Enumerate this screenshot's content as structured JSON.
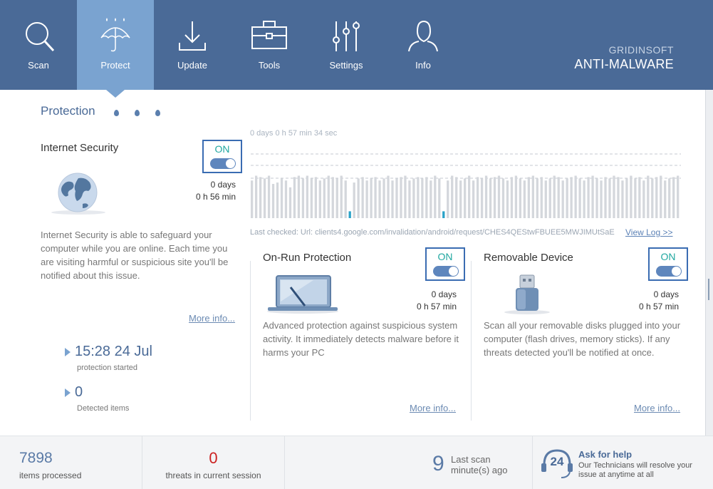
{
  "nav": {
    "tabs": [
      {
        "label": "Scan",
        "icon": "magnifier-icon"
      },
      {
        "label": "Protect",
        "icon": "umbrella-icon",
        "active": true
      },
      {
        "label": "Update",
        "icon": "download-icon"
      },
      {
        "label": "Tools",
        "icon": "toolbox-icon"
      },
      {
        "label": "Settings",
        "icon": "sliders-icon"
      },
      {
        "label": "Info",
        "icon": "person-icon"
      }
    ]
  },
  "brand": {
    "top": "GRIDINSOFT",
    "bottom": "ANTI-MALWARE"
  },
  "protection": {
    "title": "Protection"
  },
  "internet_security": {
    "title": "Internet Security",
    "toggle": "ON",
    "days": "0 days",
    "time": "0 h 56 min",
    "description": "Internet Security is able to safeguard your computer while you are online. Each time you are visiting harmful or suspicious site you'll  be notified about this issue.",
    "more": "More info..."
  },
  "stats": {
    "started_value": "15:28 24 Jul",
    "started_label": "protection started",
    "detected_value": "0",
    "detected_label": "Detected items"
  },
  "chart": {
    "elapsed": "0 days 0 h 57 min 34 sec",
    "last_checked": "Last checked: Url: clients4.google.com/invalidation/android/request/CHES4QEStwFBUEE5MWJIMUtSaE",
    "view_log": "View Log >>",
    "bar_color": "#d4d7dc",
    "highlight_color": "#2aa2c8"
  },
  "chart_data": {
    "type": "bar",
    "values": [
      0.55,
      0.62,
      0.6,
      0.58,
      0.62,
      0.5,
      0.52,
      0.58,
      0.55,
      0.45,
      0.6,
      0.62,
      0.58,
      0.62,
      0.58,
      0.6,
      0.55,
      0.58,
      0.62,
      0.6,
      0.58,
      0.62,
      0.55,
      0.1,
      0.52,
      0.58,
      0.6,
      0.55,
      0.58,
      0.6,
      0.55,
      0.58,
      0.62,
      0.55,
      0.58,
      0.6,
      0.62,
      0.55,
      0.58,
      0.6,
      0.58,
      0.6,
      0.55,
      0.62,
      0.58,
      0.1,
      0.55,
      0.62,
      0.6,
      0.55,
      0.58,
      0.62,
      0.55,
      0.6,
      0.58,
      0.62,
      0.58,
      0.6,
      0.62,
      0.58,
      0.55,
      0.6,
      0.62,
      0.58,
      0.55,
      0.6,
      0.62,
      0.58,
      0.6,
      0.55,
      0.58,
      0.62,
      0.6,
      0.55,
      0.58,
      0.6,
      0.62,
      0.58,
      0.55,
      0.6,
      0.62,
      0.58,
      0.55,
      0.6,
      0.58,
      0.62,
      0.6,
      0.55,
      0.58,
      0.62,
      0.58,
      0.6,
      0.55,
      0.62,
      0.58,
      0.6,
      0.62,
      0.55,
      0.58,
      0.6,
      0.62
    ],
    "highlight_indexes": [
      23,
      45
    ]
  },
  "on_run": {
    "title": "On-Run Protection",
    "toggle": "ON",
    "days": "0 days",
    "time": "0 h 57 min",
    "description": "Advanced protection against suspicious system activity. It immediately detects malware before it harms your PC",
    "more": "More info..."
  },
  "removable": {
    "title": "Removable Device",
    "toggle": "ON",
    "days": "0 days",
    "time": "0 h 57 min",
    "description": "Scan all your removable disks plugged into your computer (flash drives, memory sticks). If any threats detected you'll be notified at once.",
    "more": "More info..."
  },
  "footer": {
    "items_value": "7898",
    "items_label": "items processed",
    "threats_value": "0",
    "threats_label": "threats in current session",
    "last_scan_value": "9",
    "last_scan_label1": "Last scan",
    "last_scan_label2": "minute(s) ago",
    "help_badge": "24",
    "help_title": "Ask for help",
    "help_text": "Our Technicians will resolve your issue at anytime at all"
  }
}
